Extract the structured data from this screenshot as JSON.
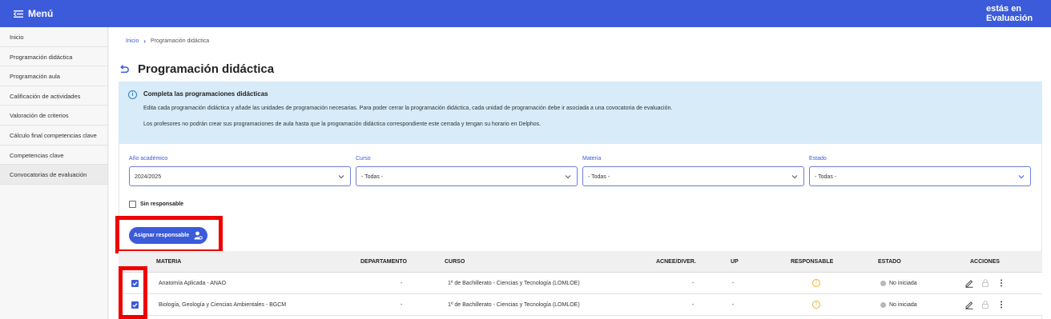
{
  "header": {
    "menu_label": "Menú",
    "eval_line1": "estás en",
    "eval_line2": "Evaluación"
  },
  "sidebar": {
    "items": [
      {
        "label": "Inicio"
      },
      {
        "label": "Programación didáctica"
      },
      {
        "label": "Programación aula"
      },
      {
        "label": "Calificación de actividades"
      },
      {
        "label": "Valoración de criterios"
      },
      {
        "label": "Cálculo final competencias clave"
      },
      {
        "label": "Competencias clave"
      },
      {
        "label": "Convocatorias de evaluación"
      }
    ]
  },
  "breadcrumb": {
    "home": "Inicio",
    "current": "Programación didáctica"
  },
  "page": {
    "title": "Programación didáctica"
  },
  "info": {
    "title": "Completa las programaciones didácticas",
    "line1": "Edita cada programación didáctica y añade las unidades de programación necesarias. Para poder cerrar la programación didáctica, cada unidad de programación debe ir asociada a una covocatoria de evaluación.",
    "line2": "Los profesores no podrán crear sus programaciones de aula hasta que la programación didáctica correspondiente este cerrada y tengan su horario en Delphos."
  },
  "filters": {
    "anio": {
      "label": "Año académico",
      "value": "2024/2025"
    },
    "curso": {
      "label": "Curso",
      "value": "- Todas -"
    },
    "materia": {
      "label": "Materia",
      "value": "- Todas -"
    },
    "estado": {
      "label": "Estado",
      "value": "- Todas -"
    }
  },
  "sin_responsable": {
    "label": "Sin responsable",
    "checked": false
  },
  "assign_button": {
    "label": "Asignar responsable"
  },
  "table": {
    "headers": {
      "materia": "MATERIA",
      "departamento": "DEPARTAMENTO",
      "curso": "CURSO",
      "acnee": "ACNEE/DIVER.",
      "up": "UP",
      "responsable": "RESPONSABLE",
      "estado": "ESTADO",
      "acciones": "ACCIONES"
    },
    "rows": [
      {
        "checked": true,
        "materia": "Anatomía Aplicada - ANAO",
        "departamento": "-",
        "curso": "1º de Bachillerato - Ciencias y Tecnología (LOMLOE)",
        "acnee": "-",
        "up": "-",
        "responsable_icon": "warning-icon",
        "estado": "No iniciada"
      },
      {
        "checked": true,
        "materia": "Biología, Geología y Ciencias Ambientales - BGCM",
        "departamento": "-",
        "curso": "1º de Bachillerato - Ciencias y Tecnología (LOMLOE)",
        "acnee": "-",
        "up": "-",
        "responsable_icon": "warning-icon",
        "estado": "No iniciada"
      }
    ]
  },
  "colors": {
    "primary": "#3b5bdb",
    "info_bg": "#d7ebf8",
    "highlight": "#ee0000",
    "warning": "#f0b429"
  }
}
